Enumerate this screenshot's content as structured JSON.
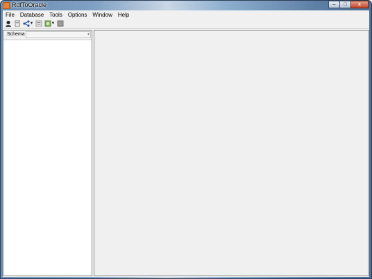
{
  "window": {
    "title": "RdfToOracle"
  },
  "menu": {
    "items": [
      "File",
      "Database",
      "Tools",
      "Options",
      "Window",
      "Help"
    ]
  },
  "window_controls": {
    "minimize": "–",
    "maximize": "□",
    "close": "x"
  },
  "toolbar": {
    "icons": [
      "user-icon",
      "document-icon",
      "share-icon",
      "dropdown-arrow-icon",
      "list-icon",
      "image-icon",
      "dropdown-arrow-icon",
      "stop-icon"
    ]
  },
  "left_panel": {
    "schema_label": "Schema",
    "schema_value": ""
  }
}
